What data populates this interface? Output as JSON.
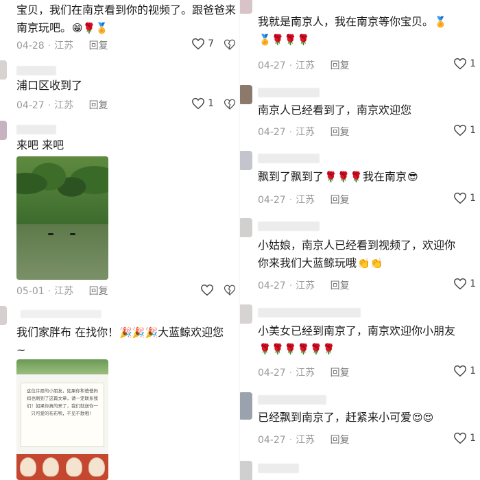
{
  "left": {
    "comments": [
      {
        "text": "宝贝，我们在南京看到你的视频了。跟爸爸来",
        "text2": "南京玩吧。",
        "emojis": "😁🌹🏅",
        "date": "04-28",
        "region": "江苏",
        "reply": "回复",
        "likes": "7"
      },
      {
        "text": "浦口区收到了",
        "date": "04-27",
        "region": "江苏",
        "reply": "回复",
        "likes": "1"
      },
      {
        "text": "来吧 来吧",
        "date": "05-01",
        "region": "江苏",
        "reply": "回复",
        "likes": ""
      },
      {
        "text": "我们家胖布  在找你！",
        "emojis": "🎉🎉🎉",
        "text_end": "大蓝鲸欢迎您",
        "text2": "~",
        "card_notice": "这位许愿的小朋友，如果你和爸爸妈妈也刷到了这篇文章，请一定联系我们！如果你真的来了，我们就送你一只可爱的布布鸭，不见不散哦！"
      }
    ]
  },
  "right": {
    "comments": [
      {
        "text": "我就是南京人，我在南京等你宝贝。",
        "emojis_inline": "🏅",
        "emojis_line2": "🏅🌹🌹🌹",
        "date": "04-27",
        "region": "江苏",
        "reply": "回复",
        "likes": "1"
      },
      {
        "text": "南京人已经看到了，南京欢迎您",
        "date": "04-27",
        "region": "江苏",
        "reply": "回复",
        "likes": "1"
      },
      {
        "text": "飘到了飘到了",
        "emojis": "🌹🌹🌹",
        "text_end": "我在南京",
        "emoji_end": "😎",
        "date": "04-27",
        "region": "江苏",
        "reply": "回复",
        "likes": "1"
      },
      {
        "text": "小姑娘，南京人已经看到视频了，欢迎你",
        "text2": "你来我们大蓝鲸玩哦",
        "emojis": "👏👏",
        "date": "04-27",
        "region": "江苏",
        "reply": "回复",
        "likes": "1"
      },
      {
        "text": "小美女已经到南京了，南京欢迎你小朋友",
        "emojis_line2": "🌹🌹🌹🌹🌹🌹",
        "date": "04-27",
        "region": "江苏",
        "reply": "回复",
        "likes": "1"
      },
      {
        "text": "已经飘到南京了，赶紧来小可爱",
        "emojis": "😍😍",
        "date": "04-27",
        "region": "江苏",
        "reply": "回复",
        "likes": "1"
      }
    ]
  }
}
